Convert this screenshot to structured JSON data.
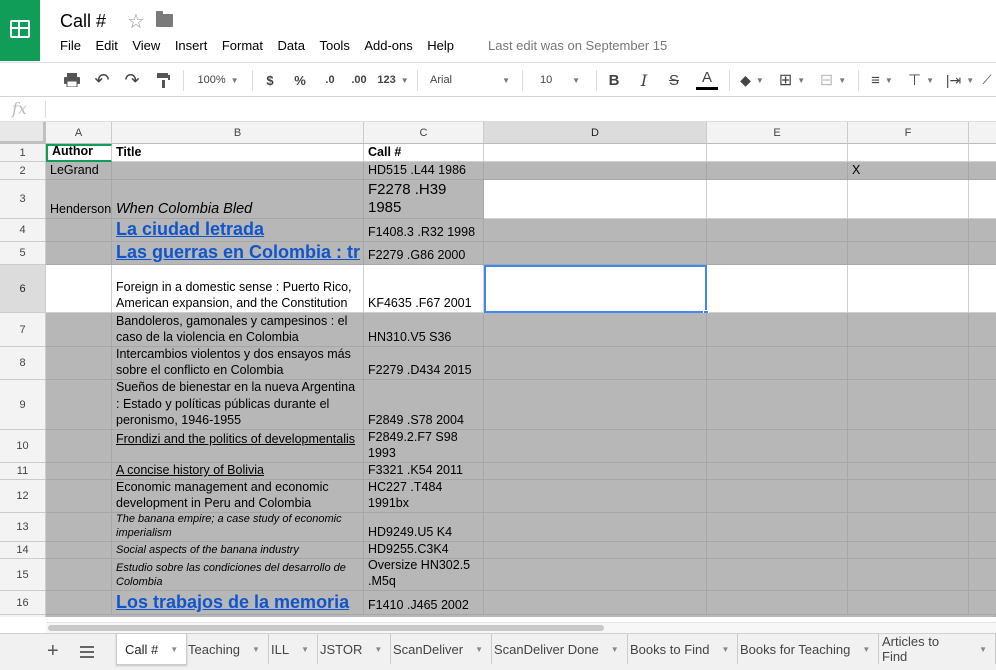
{
  "app": {
    "doc_title": "Call #",
    "last_edit": "Last edit was on September 15",
    "brand_color": "#0f9d58"
  },
  "menu": [
    "File",
    "Edit",
    "View",
    "Insert",
    "Format",
    "Data",
    "Tools",
    "Add-ons",
    "Help"
  ],
  "toolbar": {
    "zoom": "100%",
    "currency": "$",
    "percent": "%",
    "decrease_decimals": ".0",
    "increase_decimals": ".00",
    "more_formats": "123",
    "font": "Arial",
    "font_size": "10",
    "bold": "B",
    "italic": "I",
    "strike": "S",
    "text_color": "A"
  },
  "formula_bar": {
    "label": "fx",
    "value": ""
  },
  "columns": [
    "A",
    "B",
    "C",
    "D",
    "E",
    "F"
  ],
  "rows": [
    {
      "n": "1",
      "author": "Author",
      "title": "Title",
      "call": "Call #",
      "f": ""
    },
    {
      "n": "2",
      "author": "LeGrand",
      "title": "",
      "call": "HD515 .L44 1986",
      "f": "X"
    },
    {
      "n": "3",
      "author": "Henderson",
      "title": "When Colombia Bled",
      "call": "F2278 .H39 1985",
      "f": ""
    },
    {
      "n": "4",
      "author": "",
      "title": "La ciudad letrada",
      "call": "F1408.3 .R32 1998",
      "f": ""
    },
    {
      "n": "5",
      "author": "",
      "title": "Las guerras en Colombia : tr",
      "call": "F2279 .G86 2000",
      "f": ""
    },
    {
      "n": "6",
      "author": "",
      "title": "Foreign in a domestic sense : Puerto Rico, American expansion, and the Constitution",
      "call": "KF4635 .F67 2001",
      "f": ""
    },
    {
      "n": "7",
      "author": "",
      "title": "Bandoleros, gamonales y campesinos : el caso de la violencia en Colombia",
      "call": "HN310.V5 S36",
      "f": ""
    },
    {
      "n": "8",
      "author": "",
      "title": "Intercambios violentos y dos ensayos más sobre el conflicto en Colombia",
      "call": "F2279 .D434 2015",
      "f": ""
    },
    {
      "n": "9",
      "author": "",
      "title": "Sueños de bienestar en la nueva Argentina : Estado y políticas públicas durante el peronismo, 1946-1955",
      "call": "F2849 .S78 2004",
      "f": ""
    },
    {
      "n": "10",
      "author": "",
      "title": "Frondizi and the politics of developmentalis",
      "call": "F2849.2.F7 S98 1993",
      "f": ""
    },
    {
      "n": "11",
      "author": "",
      "title": "A concise history of Bolivia",
      "call": "F3321 .K54 2011",
      "f": ""
    },
    {
      "n": "12",
      "author": "",
      "title": "Economic management and economic development in Peru and Colombia",
      "call": "HC227 .T484 1991bx",
      "f": ""
    },
    {
      "n": "13",
      "author": "",
      "title": "The banana empire; a case study of economic imperialism",
      "call": "HD9249.U5 K4",
      "f": ""
    },
    {
      "n": "14",
      "author": "",
      "title": "Social aspects of the banana industry",
      "call": "HD9255.C3K4",
      "f": ""
    },
    {
      "n": "15",
      "author": "",
      "title": "Estudio sobre las condiciones del desarrollo de Colombia",
      "call": "Oversize HN302.5 .M5q",
      "f": ""
    },
    {
      "n": "16",
      "author": "",
      "title": "Los trabajos de la memoria",
      "call": "F1410 .J465 2002",
      "f": ""
    }
  ],
  "tabs": [
    "Call #",
    "Teaching",
    "ILL",
    "JSTOR",
    "ScanDeliver",
    "ScanDeliver Done",
    "Books to Find",
    "Books for Teaching",
    "Articles to Find"
  ]
}
